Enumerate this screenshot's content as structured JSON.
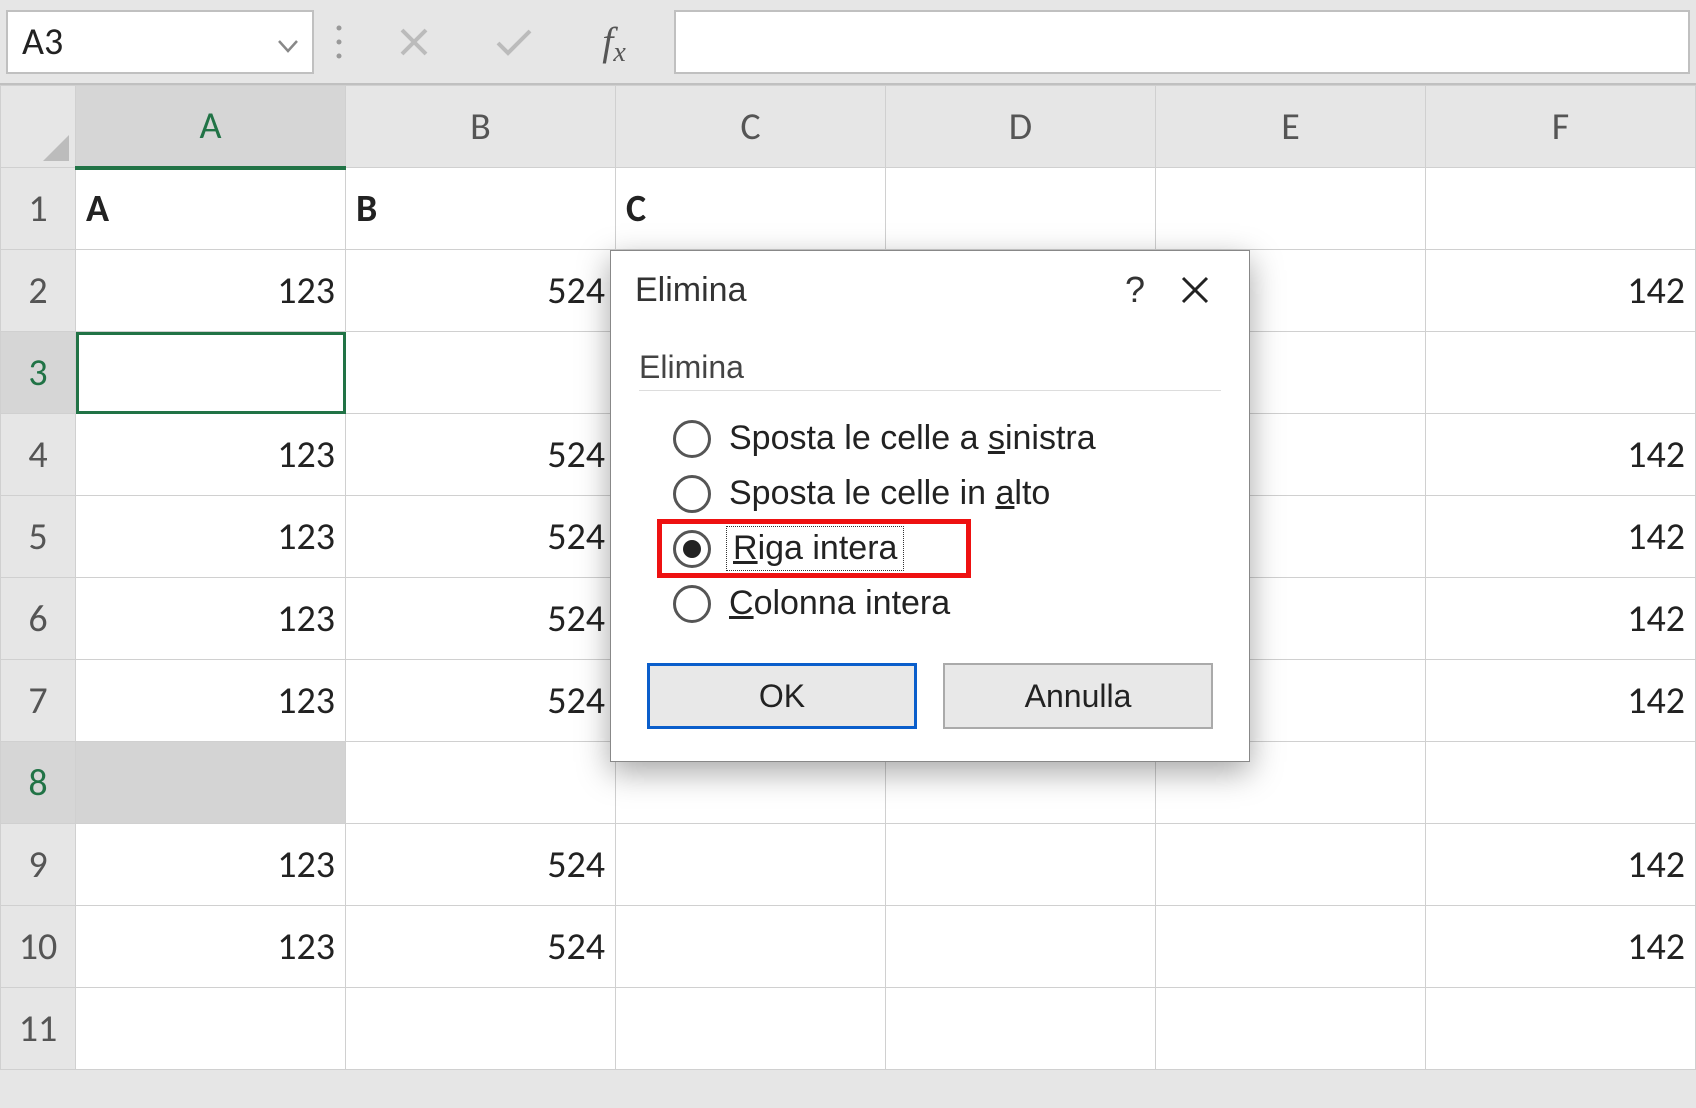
{
  "formula_bar": {
    "name_box": "A3",
    "formula_value": ""
  },
  "columns": [
    "A",
    "B",
    "C",
    "D",
    "E",
    "F"
  ],
  "active_column": "A",
  "rows": [
    {
      "n": "1",
      "sel": false,
      "cells": [
        {
          "v": "A",
          "bold": true,
          "align": "left"
        },
        {
          "v": "B",
          "bold": true,
          "align": "left"
        },
        {
          "v": "C",
          "bold": true,
          "align": "left"
        },
        {
          "v": "",
          "align": "right"
        },
        {
          "v": "",
          "align": "right"
        },
        {
          "v": "",
          "align": "right"
        }
      ]
    },
    {
      "n": "2",
      "sel": false,
      "cells": [
        {
          "v": "123",
          "align": "right"
        },
        {
          "v": "524",
          "align": "right"
        },
        {
          "v": "",
          "align": "right"
        },
        {
          "v": "",
          "align": "right"
        },
        {
          "v": "",
          "align": "right"
        },
        {
          "v": "142",
          "align": "right"
        }
      ]
    },
    {
      "n": "3",
      "sel": true,
      "active": true,
      "cells": [
        {
          "v": "",
          "align": "right",
          "selected": true
        },
        {
          "v": "",
          "align": "right"
        },
        {
          "v": "",
          "align": "right"
        },
        {
          "v": "",
          "align": "right"
        },
        {
          "v": "",
          "align": "right"
        },
        {
          "v": "",
          "align": "right"
        }
      ]
    },
    {
      "n": "4",
      "sel": false,
      "cells": [
        {
          "v": "123",
          "align": "right"
        },
        {
          "v": "524",
          "align": "right"
        },
        {
          "v": "",
          "align": "right"
        },
        {
          "v": "",
          "align": "right"
        },
        {
          "v": "",
          "align": "right"
        },
        {
          "v": "142",
          "align": "right"
        }
      ]
    },
    {
      "n": "5",
      "sel": false,
      "cells": [
        {
          "v": "123",
          "align": "right"
        },
        {
          "v": "524",
          "align": "right"
        },
        {
          "v": "",
          "align": "right"
        },
        {
          "v": "",
          "align": "right"
        },
        {
          "v": "",
          "align": "right"
        },
        {
          "v": "142",
          "align": "right"
        }
      ]
    },
    {
      "n": "6",
      "sel": false,
      "cells": [
        {
          "v": "123",
          "align": "right"
        },
        {
          "v": "524",
          "align": "right"
        },
        {
          "v": "",
          "align": "right"
        },
        {
          "v": "",
          "align": "right"
        },
        {
          "v": "",
          "align": "right"
        },
        {
          "v": "142",
          "align": "right"
        }
      ]
    },
    {
      "n": "7",
      "sel": false,
      "cells": [
        {
          "v": "123",
          "align": "right"
        },
        {
          "v": "524",
          "align": "right"
        },
        {
          "v": "",
          "align": "right"
        },
        {
          "v": "",
          "align": "right"
        },
        {
          "v": "",
          "align": "right"
        },
        {
          "v": "142",
          "align": "right"
        }
      ]
    },
    {
      "n": "8",
      "sel": true,
      "cells": [
        {
          "v": "",
          "align": "right",
          "shaded": true
        },
        {
          "v": "",
          "align": "right"
        },
        {
          "v": "",
          "align": "right"
        },
        {
          "v": "",
          "align": "right"
        },
        {
          "v": "",
          "align": "right"
        },
        {
          "v": "",
          "align": "right"
        }
      ]
    },
    {
      "n": "9",
      "sel": false,
      "cells": [
        {
          "v": "123",
          "align": "right"
        },
        {
          "v": "524",
          "align": "right"
        },
        {
          "v": "",
          "align": "right"
        },
        {
          "v": "",
          "align": "right"
        },
        {
          "v": "",
          "align": "right"
        },
        {
          "v": "142",
          "align": "right"
        }
      ]
    },
    {
      "n": "10",
      "sel": false,
      "cells": [
        {
          "v": "123",
          "align": "right"
        },
        {
          "v": "524",
          "align": "right"
        },
        {
          "v": "",
          "align": "right"
        },
        {
          "v": "",
          "align": "right"
        },
        {
          "v": "",
          "align": "right"
        },
        {
          "v": "142",
          "align": "right"
        }
      ]
    },
    {
      "n": "11",
      "sel": false,
      "cells": [
        {
          "v": "",
          "align": "right"
        },
        {
          "v": "",
          "align": "right"
        },
        {
          "v": "",
          "align": "right"
        },
        {
          "v": "",
          "align": "right"
        },
        {
          "v": "",
          "align": "right"
        },
        {
          "v": "",
          "align": "right"
        }
      ]
    }
  ],
  "dialog": {
    "title": "Elimina",
    "group_label": "Elimina",
    "options": {
      "shift_left": {
        "pre": "Sposta le celle a ",
        "u": "s",
        "post": "inistra"
      },
      "shift_up": {
        "pre": "Sposta le celle in ",
        "u": "a",
        "post": "lto"
      },
      "entire_row": {
        "pre": "",
        "u": "R",
        "post": "iga intera"
      },
      "entire_col": {
        "pre": "",
        "u": "C",
        "post": "olonna intera"
      }
    },
    "selected": "entire_row",
    "ok": "OK",
    "cancel": "Annulla"
  }
}
